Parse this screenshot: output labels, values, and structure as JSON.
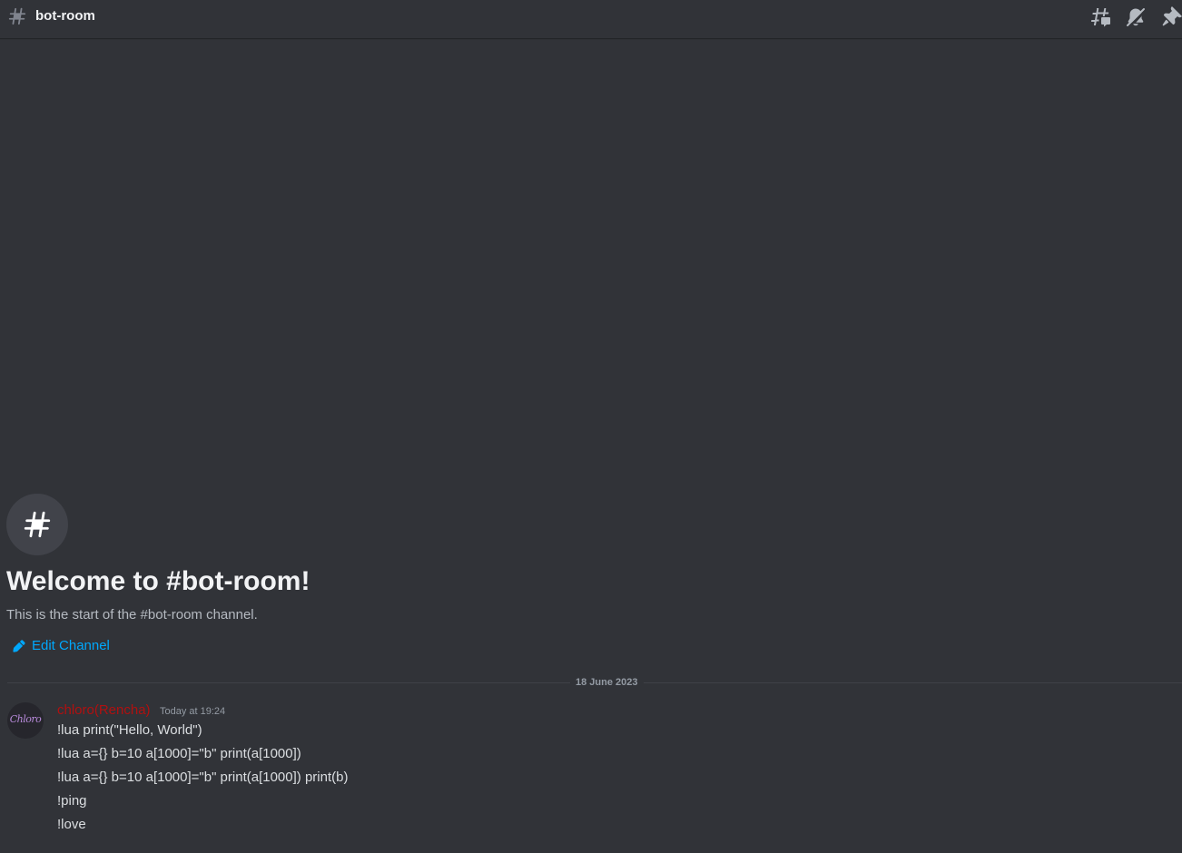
{
  "header": {
    "channel_name": "bot-room",
    "tools": [
      {
        "name": "threads-icon"
      },
      {
        "name": "notification-muted-icon"
      },
      {
        "name": "pin-icon"
      }
    ]
  },
  "welcome": {
    "title": "Welcome to #bot-room!",
    "subtitle": "This is the start of the #bot-room channel.",
    "edit_label": "Edit Channel"
  },
  "divider": {
    "date": "18 June 2023"
  },
  "message": {
    "avatar_text": "Chloro",
    "username": "chloro(Rencha)",
    "timestamp": "Today at 19:24",
    "lines": [
      "!lua print(\"Hello, World\")",
      "!lua a={} b=10 a[1000]=\"b\" print(a[1000])",
      "!lua a={} b=10 a[1000]=\"b\" print(a[1000]) print(b)",
      "!ping",
      "!love"
    ]
  },
  "colors": {
    "background": "#313338",
    "username": "#b11010",
    "link": "#00a8fc",
    "muted_text": "#b5bac1"
  }
}
